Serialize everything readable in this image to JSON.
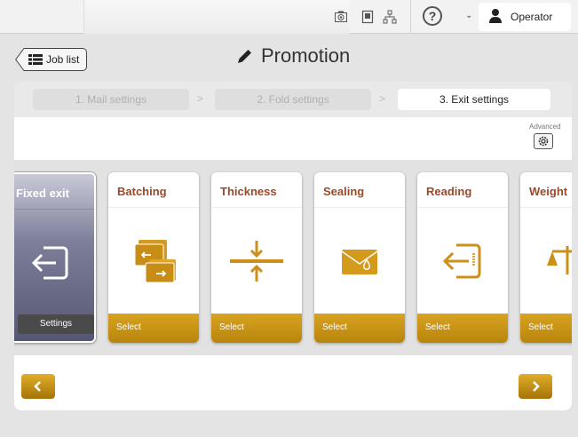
{
  "status_bar": {
    "icons": [
      "camera-icon",
      "device-icon",
      "network-icon",
      "help-icon",
      "user-icon"
    ],
    "help_label": "?",
    "user": {
      "name": "Operator"
    }
  },
  "header": {
    "back_button_label": "Job list",
    "title": "Promotion"
  },
  "steps": [
    {
      "label": "1. Mail settings",
      "state": "inactive"
    },
    {
      "label": "2. Fold settings",
      "state": "inactive"
    },
    {
      "label": "3. Exit settings",
      "state": "active"
    }
  ],
  "advanced": {
    "label": "Advanced",
    "icon": "gear-icon"
  },
  "cards": [
    {
      "title": "Fixed exit",
      "action": "Settings",
      "icon": "exit-icon",
      "selected": true
    },
    {
      "title": "Batching",
      "action": "Select",
      "icon": "batching-icon",
      "selected": false
    },
    {
      "title": "Thickness",
      "action": "Select",
      "icon": "thickness-icon",
      "selected": false
    },
    {
      "title": "Sealing",
      "action": "Select",
      "icon": "sealing-icon",
      "selected": false
    },
    {
      "title": "Reading",
      "action": "Select",
      "icon": "reading-icon",
      "selected": false
    },
    {
      "title": "Weight",
      "action": "Select",
      "icon": "weight-icon",
      "selected": false
    }
  ],
  "navigation": {
    "prev_icon": "chevron-left-icon",
    "next_icon": "chevron-right-icon"
  },
  "colors": {
    "accent": "#c8931a",
    "selected_card": "#6b6d8a",
    "title_text": "#9a4a2a"
  }
}
